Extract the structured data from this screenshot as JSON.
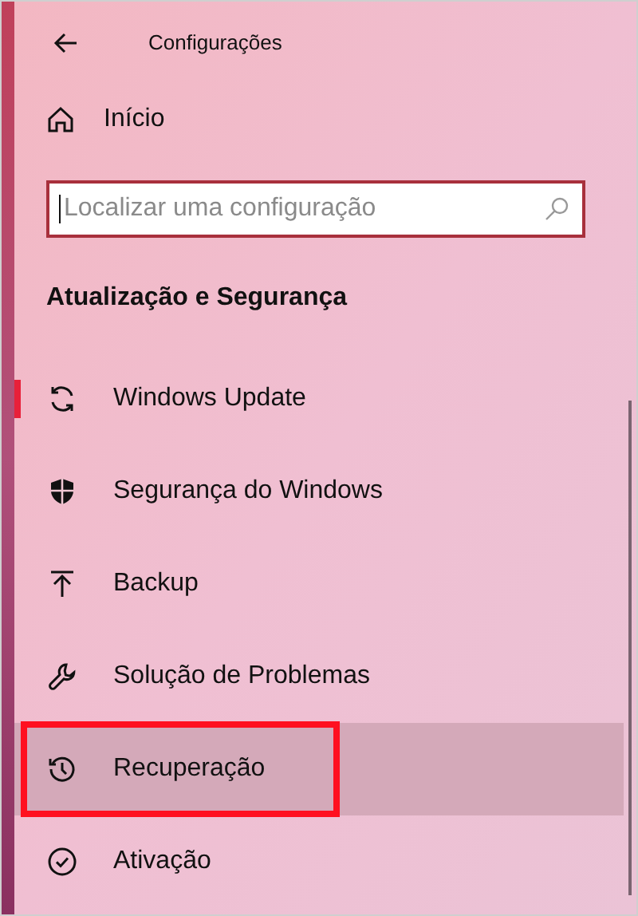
{
  "window": {
    "title": "Configurações"
  },
  "home": {
    "label": "Início"
  },
  "search": {
    "placeholder": "Localizar uma configuração"
  },
  "section": {
    "title": "Atualização e Segurança"
  },
  "items": [
    {
      "kind": "sync",
      "label": "Windows Update",
      "selected": true,
      "hovered": false,
      "highlighted": false
    },
    {
      "kind": "shield",
      "label": "Segurança do Windows",
      "selected": false,
      "hovered": false,
      "highlighted": false
    },
    {
      "kind": "upload",
      "label": "Backup",
      "selected": false,
      "hovered": false,
      "highlighted": false
    },
    {
      "kind": "wrench",
      "label": "Solução de Problemas",
      "selected": false,
      "hovered": false,
      "highlighted": false
    },
    {
      "kind": "history",
      "label": "Recuperação",
      "selected": false,
      "hovered": true,
      "highlighted": true
    },
    {
      "kind": "check",
      "label": "Ativação",
      "selected": false,
      "hovered": false,
      "highlighted": false
    }
  ]
}
